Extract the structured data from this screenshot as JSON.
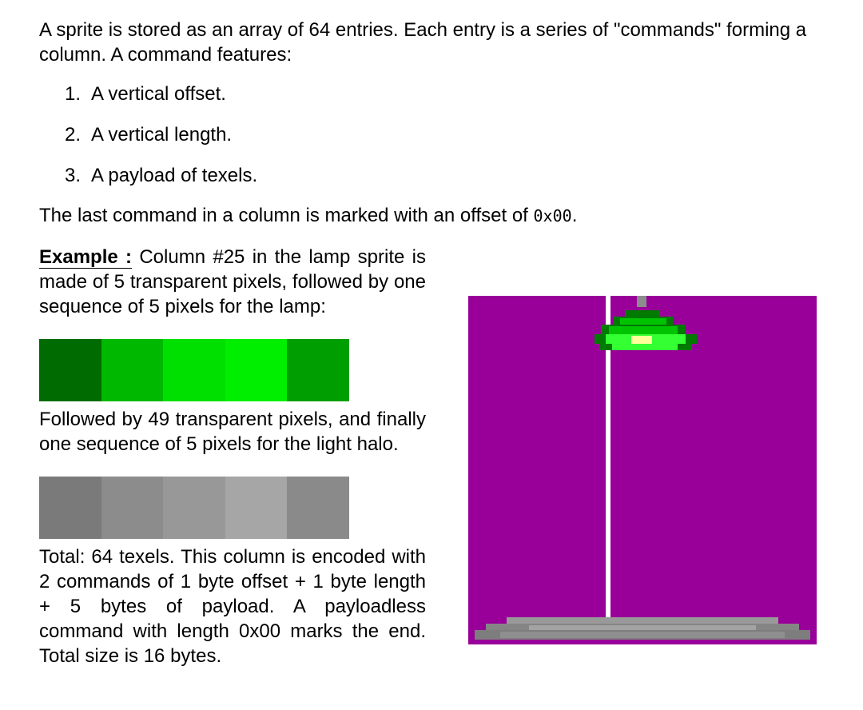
{
  "intro": "A sprite is stored as an array of 64 entries. Each entry is a series of \"commands\" forming a column. A command features:",
  "features": [
    {
      "num": "1.",
      "text": "A vertical offset."
    },
    {
      "num": "2.",
      "text": "A vertical length."
    },
    {
      "num": "3.",
      "text": "A payload of texels."
    }
  ],
  "last_command": {
    "text": "The last command in a column is marked with an offset of ",
    "code": "0x00",
    "end": "."
  },
  "example": {
    "label": "Example :",
    "text": " Column #25 in the lamp sprite is made of 5 transparent pixels, followed by one sequence of 5 pixels for the lamp:"
  },
  "lamp_pixels": [
    "#006b00",
    "#00b800",
    "#00e000",
    "#00ee00",
    "#009e00"
  ],
  "followed": "Followed by 49 transparent pixels, and finally one sequence of 5 pixels for the light halo.",
  "halo_pixels": [
    "#7a7a7a",
    "#8c8c8c",
    "#989898",
    "#a6a6a6",
    "#8a8a8a"
  ],
  "total": "Total: 64 texels. This column is encoded with 2 commands of 1 byte offset + 1 byte length + 5 bytes of payload. A payloadless command with length 0x00 marks the end. Total size is 16 bytes.",
  "sprite_colors": {
    "background": "#990099",
    "pole": "#ffffff",
    "shade_dark": "#007a00",
    "shade_mid": "#00c400",
    "shade_light": "#33ff33",
    "glow": "#ffff99",
    "base": "#8c8c8c"
  }
}
